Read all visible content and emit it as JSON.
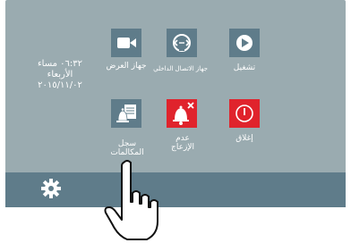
{
  "datetime": {
    "time": "٠٦:٣٢ مساء",
    "day": "الأربعاء",
    "date": "٢٠١٥/١١/٠٢"
  },
  "tiles": {
    "display_device": {
      "label": "جهاز العرض",
      "icon": "video-camera-icon",
      "bg": "#5f7c8a"
    },
    "internal_connection": {
      "label": "جهاز الاتصال الداخلي",
      "icon": "intercom-icon",
      "bg": "#5f7c8a"
    },
    "play": {
      "label": "تشغيل",
      "icon": "play-icon",
      "bg": "#5f7c8a"
    },
    "call_log": {
      "label_line1": "سجل",
      "label_line2": "المكالمات",
      "icon": "call-log-icon",
      "bg": "#5f7c8a"
    },
    "do_not_disturb": {
      "label_line1": "عدم",
      "label_line2": "الإزعاج",
      "icon": "bell-mute-icon",
      "bg": "#e0232c"
    },
    "close": {
      "label": "إغلاق",
      "icon": "power-icon",
      "bg": "#e0232c"
    }
  },
  "bottom_bar": {
    "settings_icon": "gear-icon"
  },
  "overlay": {
    "pointer": "hand-pointer-icon"
  }
}
